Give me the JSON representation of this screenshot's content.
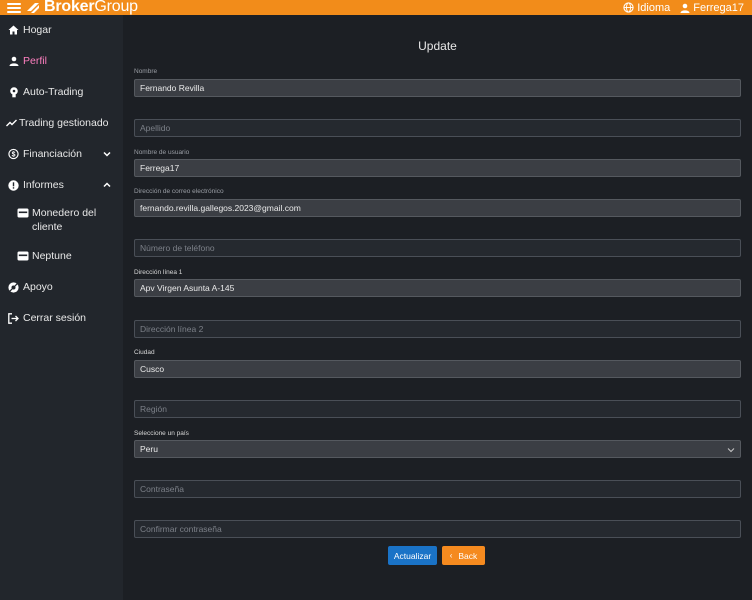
{
  "header": {
    "brand_bold": "Broker",
    "brand_light": "Group",
    "language_label": "Idioma",
    "username": "Ferrega17",
    "accent_color": "#f28c1a"
  },
  "sidebar": {
    "items": [
      {
        "label": "Hogar",
        "icon": "home-icon"
      },
      {
        "label": "Perfil",
        "icon": "user-icon",
        "active": true
      },
      {
        "label": "Auto-Trading",
        "icon": "bulb-icon"
      },
      {
        "label": "Trading gestionado",
        "icon": "trend-icon"
      },
      {
        "label": "Financiación",
        "icon": "finance-icon",
        "expand": "collapsed"
      },
      {
        "label": "Informes",
        "icon": "info-icon",
        "expand": "expanded"
      },
      {
        "label": "Monedero del cliente",
        "icon": "wallet-icon"
      },
      {
        "label": "Neptune",
        "icon": "wallet-icon"
      },
      {
        "label": "Apoyo",
        "icon": "support-icon"
      },
      {
        "label": "Cerrar sesión",
        "icon": "logout-icon"
      }
    ],
    "active_color": "#ff7fc0"
  },
  "form": {
    "title": "Update",
    "nombre_label": "Nombre",
    "nombre_value": "Fernando Revilla",
    "apellido_placeholder": "Apellido",
    "usuario_label": "Nombre de usuario",
    "usuario_value": "Ferrega17",
    "email_label": "Dirección de correo electrónico",
    "email_value": "fernando.revilla.gallegos.2023@gmail.com",
    "telefono_placeholder": "Número de teléfono",
    "direccion1_label": "Dirección línea 1",
    "direccion1_value": "Apv Virgen Asunta A-145",
    "direccion2_placeholder": "Dirección línea 2",
    "ciudad_label": "Ciudad",
    "ciudad_value": "Cusco",
    "region_placeholder": "Región",
    "pais_label": "Seleccione un país",
    "pais_value": "Peru",
    "password_placeholder": "Contraseña",
    "confirm_placeholder": "Confirmar contraseña",
    "update_button": "Actualizar",
    "back_button": "Back",
    "back_arrow": "‹",
    "update_color": "#1a73c7",
    "back_color": "#f58a1f"
  }
}
